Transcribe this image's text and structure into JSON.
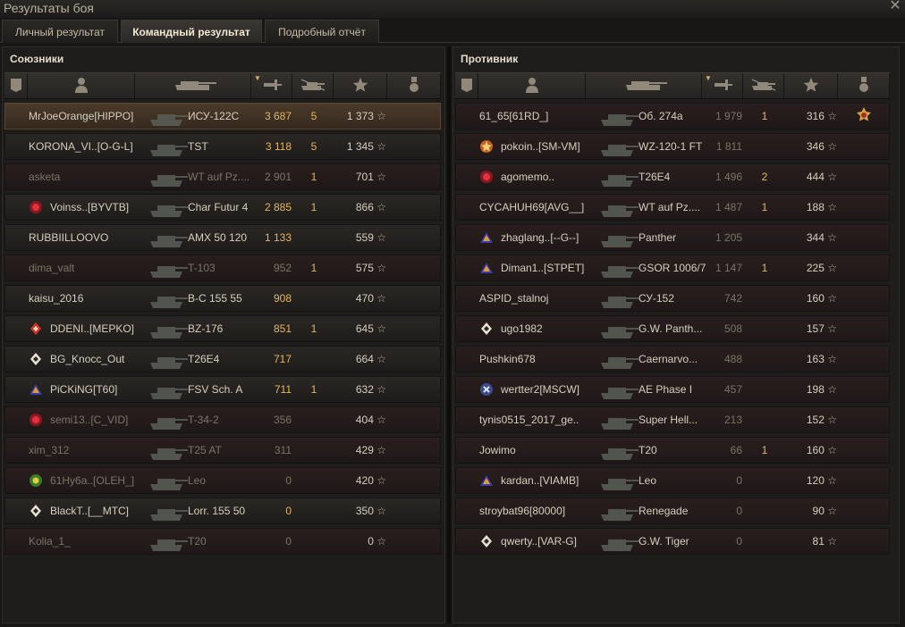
{
  "window": {
    "title": "Результаты боя"
  },
  "tabs": [
    {
      "label": "Личный результат",
      "active": false
    },
    {
      "label": "Командный результат",
      "active": true
    },
    {
      "label": "Подробный отчёт",
      "active": false
    }
  ],
  "allies": {
    "title": "Союзники",
    "rows": [
      {
        "player": "MrJoeOrange[HIPPO]",
        "tank": "ИСУ-122С",
        "damage": "3 687",
        "kills": "5",
        "xp": "1 373",
        "style": "me",
        "clan": null
      },
      {
        "player": "KORONA_VI..[O-G-L]",
        "tank": "TST",
        "damage": "3 118",
        "kills": "5",
        "xp": "1 345",
        "style": "",
        "clan": null
      },
      {
        "player": "asketa",
        "tank": "WT auf Pz....",
        "damage": "2 901",
        "kills": "1",
        "xp": "701",
        "style": "dark",
        "clan": null,
        "dim": true
      },
      {
        "player": "Voinss..[BYVTB]",
        "tank": "Char Futur 4",
        "damage": "2 885",
        "kills": "1",
        "xp": "866",
        "style": "",
        "clan": "red"
      },
      {
        "player": "RUBBIILLOOVO",
        "tank": "AMX 50 120",
        "damage": "1 133",
        "kills": "",
        "xp": "559",
        "style": "",
        "clan": null
      },
      {
        "player": "dima_valt",
        "tank": "T-103",
        "damage": "952",
        "kills": "1",
        "xp": "575",
        "style": "dark",
        "clan": null,
        "dim": true
      },
      {
        "player": "kaisu_2016",
        "tank": "B-C 155 55",
        "damage": "908",
        "kills": "",
        "xp": "470",
        "style": "",
        "clan": null
      },
      {
        "player": "DDENI..[MEPKO]",
        "tank": "BZ-176",
        "damage": "851",
        "kills": "1",
        "xp": "645",
        "style": "",
        "clan": "diamond-red"
      },
      {
        "player": "BG_Knocc_Out",
        "tank": "T26E4",
        "damage": "717",
        "kills": "",
        "xp": "664",
        "style": "",
        "clan": "diamond"
      },
      {
        "player": "PiCKiNG[T60]",
        "tank": "FSV Sch. A",
        "damage": "711",
        "kills": "1",
        "xp": "632",
        "style": "",
        "clan": "flag"
      },
      {
        "player": "semi13..[C_VID]",
        "tank": "T-34-2",
        "damage": "356",
        "kills": "",
        "xp": "404",
        "style": "dark",
        "clan": "red",
        "dim": true
      },
      {
        "player": "xim_312",
        "tank": "T25 AT",
        "damage": "311",
        "kills": "",
        "xp": "429",
        "style": "dark",
        "clan": null,
        "dim": true
      },
      {
        "player": "61Ну6а..[OLEH_]",
        "tank": "Leo",
        "damage": "0",
        "kills": "",
        "xp": "420",
        "style": "dark",
        "clan": "green",
        "dim": true
      },
      {
        "player": "BlackT..[__MTC]",
        "tank": "Lorr. 155 50",
        "damage": "0",
        "kills": "",
        "xp": "350",
        "style": "",
        "clan": "diamond"
      },
      {
        "player": "Kolia_1_",
        "tank": "T20",
        "damage": "0",
        "kills": "",
        "xp": "0",
        "style": "dark",
        "clan": null,
        "dim": true
      }
    ]
  },
  "enemies": {
    "title": "Противник",
    "rows": [
      {
        "player": "61_65[61RD_]",
        "tank": "Об. 274а",
        "damage": "1 979",
        "kills": "1",
        "xp": "316",
        "style": "dark",
        "clan": null,
        "medal": "order-icon"
      },
      {
        "player": "pokoin..[SM-VM]",
        "tank": "WZ-120-1 FT",
        "damage": "1 811",
        "kills": "",
        "xp": "346",
        "style": "dark",
        "clan": "star"
      },
      {
        "player": "agomemo..",
        "tank": "T26E4",
        "damage": "1 496",
        "kills": "2",
        "xp": "444",
        "style": "dark",
        "clan": "red"
      },
      {
        "player": "CYCAHUH69[AVG__]",
        "tank": "WT auf Pz....",
        "damage": "1 487",
        "kills": "1",
        "xp": "188",
        "style": "dark",
        "clan": null
      },
      {
        "player": "zhaglang..[--G--]",
        "tank": "Panther",
        "damage": "1 205",
        "kills": "",
        "xp": "344",
        "style": "dark",
        "clan": "flag"
      },
      {
        "player": "Diman1..[STPET]",
        "tank": "GSOR 1006/7",
        "damage": "1 147",
        "kills": "1",
        "xp": "225",
        "style": "dark",
        "clan": "flag"
      },
      {
        "player": "ASPID_stalnoj",
        "tank": "СУ-152",
        "damage": "742",
        "kills": "",
        "xp": "160",
        "style": "dark",
        "clan": null
      },
      {
        "player": "ugo1982",
        "tank": "G.W. Panth...",
        "damage": "508",
        "kills": "",
        "xp": "157",
        "style": "dark",
        "clan": "diamond"
      },
      {
        "player": "Pushkin678",
        "tank": "Caernarvo...",
        "damage": "488",
        "kills": "",
        "xp": "163",
        "style": "dark",
        "clan": null
      },
      {
        "player": "wertter2[MSCW]",
        "tank": "AE Phase I",
        "damage": "457",
        "kills": "",
        "xp": "198",
        "style": "dark",
        "clan": "blue"
      },
      {
        "player": "tynis0515_2017_ge..",
        "tank": "Super Hell...",
        "damage": "213",
        "kills": "",
        "xp": "152",
        "style": "dark",
        "clan": null
      },
      {
        "player": "Jowimo",
        "tank": "T20",
        "damage": "66",
        "kills": "1",
        "xp": "160",
        "style": "dark",
        "clan": null
      },
      {
        "player": "kardan..[VIAMB]",
        "tank": "Leo",
        "damage": "0",
        "kills": "",
        "xp": "120",
        "style": "dark",
        "clan": "flag"
      },
      {
        "player": "stroybat96[80000]",
        "tank": "Renegade",
        "damage": "0",
        "kills": "",
        "xp": "90",
        "style": "dark",
        "clan": null
      },
      {
        "player": "qwerty..[VAR-G]",
        "tank": "G.W. Tiger",
        "damage": "0",
        "kills": "",
        "xp": "81",
        "style": "dark",
        "clan": "diamond"
      }
    ]
  },
  "columns": [
    {
      "name": "squad-column",
      "icon": "squad-icon"
    },
    {
      "name": "player-column",
      "icon": "player-icon"
    },
    {
      "name": "tank-column",
      "icon": "tank-icon"
    },
    {
      "name": "damage-column",
      "icon": "damage-icon",
      "sorted": true
    },
    {
      "name": "kills-column",
      "icon": "kills-icon"
    },
    {
      "name": "xp-column",
      "icon": "xp-star-icon"
    },
    {
      "name": "medal-column",
      "icon": "medal-icon"
    }
  ],
  "colors": {
    "gold": "#e5b65e",
    "text": "#d6cfbf",
    "dim": "#7a7468"
  }
}
